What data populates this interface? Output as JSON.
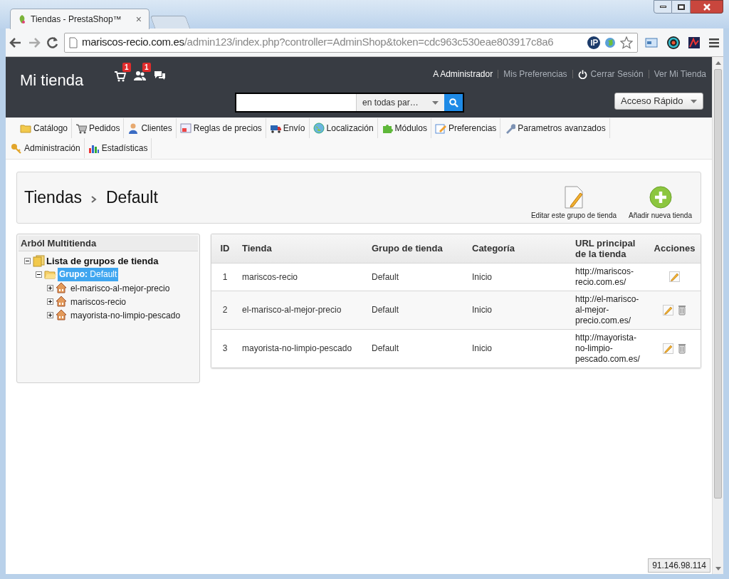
{
  "browser": {
    "tab_title": "Tiendas - PrestaShop™",
    "tab_close": "×",
    "url_host": "mariscos-recio.com.es",
    "url_path": "/admin123/index.php?controller=AdminShop&token=cdc963c530eae803917c8a6"
  },
  "header": {
    "logo": "Mi tienda",
    "notifications": [
      {
        "kind": "orders",
        "count": "1"
      },
      {
        "kind": "customers",
        "count": "1"
      },
      {
        "kind": "messages"
      }
    ],
    "user_links": [
      "A Administrador",
      "Mis Preferencias",
      "Cerrar Sesión",
      "Ver Mi Tienda"
    ],
    "search": {
      "scope": "en todas par…"
    },
    "quick_access": "Acceso Rápido"
  },
  "menu": [
    [
      "Catálogo",
      "Pedidos",
      "Clientes",
      "Reglas de precios",
      "Envío",
      "Localización",
      "Módulos",
      "Preferencias",
      "Parametros avanzados"
    ],
    [
      "Administración",
      "Estadísticas"
    ]
  ],
  "page_title": {
    "section": "Tiendas",
    "current": "Default"
  },
  "toolbar": [
    "Editar este grupo de tienda",
    "Añadir nueva tienda"
  ],
  "tree": {
    "title": "Arból Multitienda",
    "root": {
      "label": "Lista de grupos de tienda",
      "expanded": true,
      "children": [
        {
          "label_prefix": "Grupo:",
          "label": "Default",
          "selected": true,
          "expanded": true,
          "children": [
            {
              "label": "el-marisco-al-mejor-precio",
              "expanded": false,
              "selected": false
            },
            {
              "label": "mariscos-recio",
              "expanded": false,
              "selected": false
            },
            {
              "label": "mayorista-no-limpio-pescado",
              "expanded": false,
              "selected": false
            }
          ]
        }
      ]
    }
  },
  "table": {
    "columns": [
      "ID",
      "Tienda",
      "Grupo de tienda",
      "Categoría",
      "URL principal de la tienda",
      "Acciones"
    ],
    "rows": [
      {
        "id": "1",
        "shop": "mariscos-recio",
        "group": "Default",
        "category": "Inicio",
        "url": "http://mariscos-recio.com.es/",
        "actions": [
          {
            "kind": "edit"
          }
        ]
      },
      {
        "id": "2",
        "shop": "el-marisco-al-mejor-precio",
        "group": "Default",
        "category": "Inicio",
        "url": "http://el-marisco-al-mejor-precio.com.es/",
        "actions": [
          {
            "kind": "edit"
          },
          {
            "kind": "delete"
          }
        ]
      },
      {
        "id": "3",
        "shop": "mayorista-no-limpio-pescado",
        "group": "Default",
        "category": "Inicio",
        "url": "http://mayorista-no-limpio-pescado.com.es/",
        "actions": [
          {
            "kind": "edit"
          },
          {
            "kind": "delete"
          }
        ]
      }
    ]
  },
  "footer_ip": "91.146.98.114"
}
